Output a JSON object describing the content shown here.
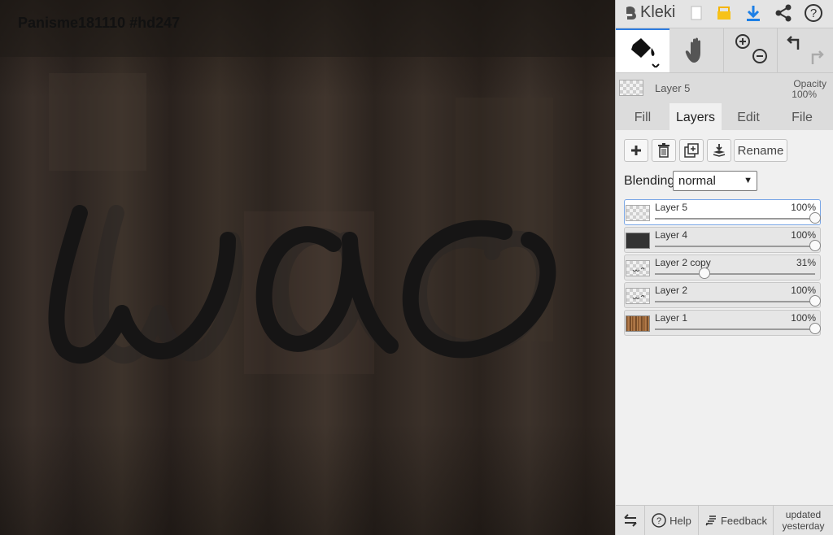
{
  "canvas": {
    "document_title": "Panisme181110 #hd247"
  },
  "app": {
    "name": "Kleki"
  },
  "current_layer": {
    "name": "Layer 5",
    "opacity_label": "Opacity",
    "opacity_value": "100%"
  },
  "tabs": [
    {
      "label": "Fill",
      "active": false
    },
    {
      "label": "Layers",
      "active": true
    },
    {
      "label": "Edit",
      "active": false
    },
    {
      "label": "File",
      "active": false
    }
  ],
  "layer_actions": {
    "rename_label": "Rename"
  },
  "blending": {
    "label": "Blending",
    "value": "normal"
  },
  "layers": [
    {
      "name": "Layer 5",
      "opacity": "100%",
      "opacity_fraction": 1.0,
      "selected": true,
      "thumb": "transparent"
    },
    {
      "name": "Layer 4",
      "opacity": "100%",
      "opacity_fraction": 1.0,
      "selected": false,
      "thumb": "dark"
    },
    {
      "name": "Layer 2 copy",
      "opacity": "31%",
      "opacity_fraction": 0.31,
      "selected": false,
      "thumb": "sketch"
    },
    {
      "name": "Layer 2",
      "opacity": "100%",
      "opacity_fraction": 1.0,
      "selected": false,
      "thumb": "sketch"
    },
    {
      "name": "Layer 1",
      "opacity": "100%",
      "opacity_fraction": 1.0,
      "selected": false,
      "thumb": "photo"
    }
  ],
  "bottom": {
    "help": "Help",
    "feedback": "Feedback",
    "updated_line1": "updated",
    "updated_line2": "yesterday"
  },
  "colors": {
    "accent": "#2f7de1",
    "panel_bg": "#dcdcdc",
    "active_tab_bg": "#f0f0f0"
  }
}
